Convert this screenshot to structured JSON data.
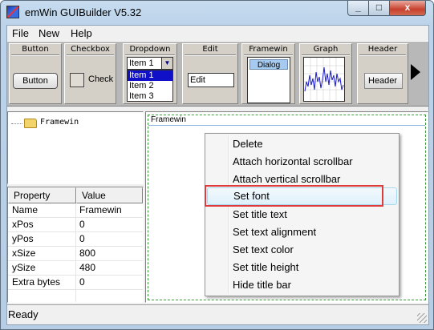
{
  "window": {
    "title": "emWin GUIBuilder V5.32",
    "minimize_glyph": "_",
    "maximize_glyph": "□",
    "close_glyph": "x"
  },
  "menu": [
    "File",
    "New",
    "Help"
  ],
  "toolbar": {
    "tools": {
      "button": {
        "label": "Button",
        "widget_text": "Button"
      },
      "checkbox": {
        "label": "Checkbox",
        "widget_text": "Check"
      },
      "dropdown": {
        "label": "Dropdown",
        "selected": "Item 1",
        "arrow": "▼",
        "options": [
          "Item 1",
          "Item 2",
          "Item 3"
        ]
      },
      "edit": {
        "label": "Edit",
        "widget_text": "Edit"
      },
      "framewin": {
        "label": "Framewin",
        "widget_text": "Dialog"
      },
      "graph": {
        "label": "Graph"
      },
      "header": {
        "label": "Header",
        "widget_text": "Header"
      }
    }
  },
  "tree": {
    "root_label": "Framewin"
  },
  "properties": {
    "headers": [
      "Property",
      "Value"
    ],
    "rows": [
      [
        "Name",
        "Framewin"
      ],
      [
        "xPos",
        "0"
      ],
      [
        "yPos",
        "0"
      ],
      [
        "xSize",
        "800"
      ],
      [
        "ySize",
        "480"
      ],
      [
        "Extra bytes",
        "0"
      ]
    ]
  },
  "editor": {
    "frame_caption": "Framewin"
  },
  "context_menu": {
    "items": [
      "Delete",
      "Attach horizontal scrollbar",
      "Attach vertical scrollbar",
      "Set font",
      "Set title text",
      "Set text alignment",
      "Set text color",
      "Set title height",
      "Hide title bar"
    ],
    "hover_index": 3
  },
  "status": {
    "text": "Ready"
  },
  "colors": {
    "highlight_box": "#e03b3b",
    "selected_option": "#1010c8"
  }
}
